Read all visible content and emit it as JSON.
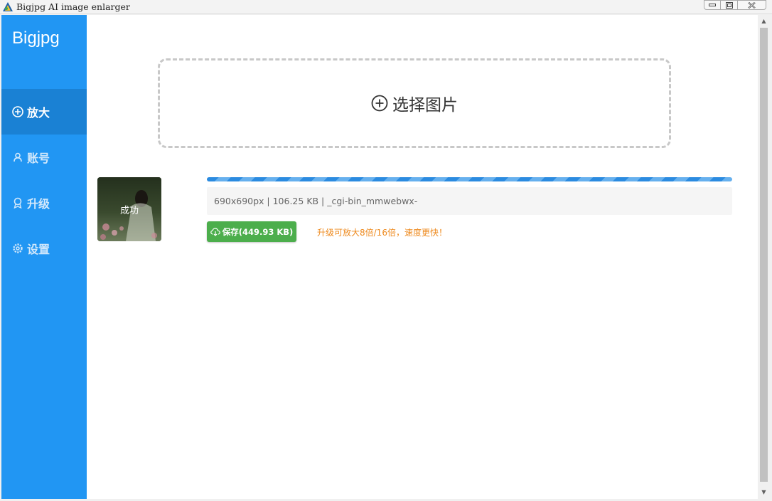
{
  "window": {
    "title": "Bigjpg AI image enlarger",
    "icon": "bigjpg-app-icon",
    "controls": {
      "minimize": "minimize-icon",
      "restore": "restore-icon",
      "close": "close-icon"
    }
  },
  "sidebar": {
    "brand": "Bigjpg",
    "color": "#2196f3",
    "active_color": "#1a81d4",
    "items": [
      {
        "label": "放大",
        "icon": "plus-circle-icon",
        "active": true
      },
      {
        "label": "账号",
        "icon": "user-icon",
        "active": false
      },
      {
        "label": "升级",
        "icon": "medal-icon",
        "active": false
      },
      {
        "label": "设置",
        "icon": "gear-icon",
        "active": false
      }
    ]
  },
  "dropzone": {
    "label": "选择图片",
    "icon": "plus-circle-icon"
  },
  "job": {
    "status": "成功",
    "progress": 1.0,
    "info": "690x690px | 106.25 KB | _cgi-bin_mmwebwx-",
    "save_label": "保存(449.93 KB)",
    "save_icon": "cloud-download-icon",
    "save_color": "#4cae4c",
    "upgrade_note": "升级可放大8倍/16倍，速度更快！",
    "note_color": "#ee8a1e"
  },
  "scrollbar": {
    "up": "▲",
    "down": "▼"
  }
}
